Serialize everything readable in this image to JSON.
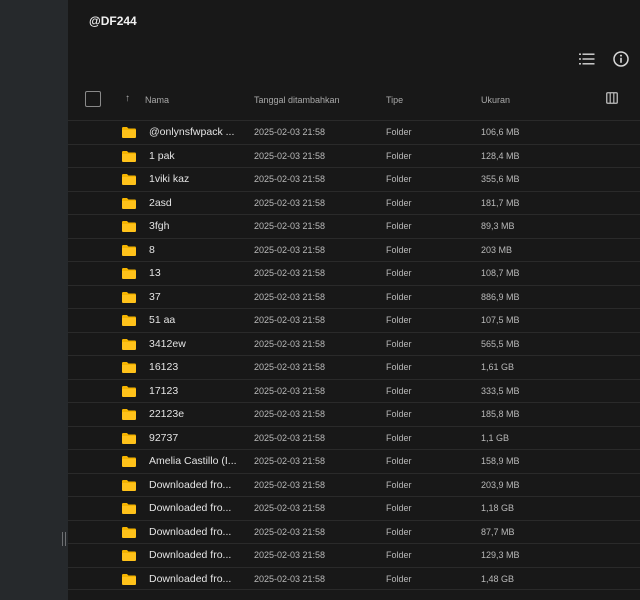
{
  "app": {
    "title": "@DF244"
  },
  "toolbar": {
    "list_view_icon": "list-view-icon",
    "info_icon": "info-icon"
  },
  "columns": {
    "name": "Nama",
    "date_added": "Tanggal ditambahkan",
    "type": "Tipe",
    "size": "Ukuran"
  },
  "colors": {
    "folder": "#f5b400",
    "background": "#181818",
    "sidebar": "#26292c"
  },
  "files": [
    {
      "name": "@onlynsfwpack ...",
      "date": "2025-02-03 21:58",
      "type": "Folder",
      "size": "106,6 MB"
    },
    {
      "name": "1 pak",
      "date": "2025-02-03 21:58",
      "type": "Folder",
      "size": "128,4 MB"
    },
    {
      "name": "1viki kaz",
      "date": "2025-02-03 21:58",
      "type": "Folder",
      "size": "355,6 MB"
    },
    {
      "name": "2asd",
      "date": "2025-02-03 21:58",
      "type": "Folder",
      "size": "181,7 MB"
    },
    {
      "name": "3fgh",
      "date": "2025-02-03 21:58",
      "type": "Folder",
      "size": "89,3 MB"
    },
    {
      "name": "8",
      "date": "2025-02-03 21:58",
      "type": "Folder",
      "size": "203 MB"
    },
    {
      "name": "13",
      "date": "2025-02-03 21:58",
      "type": "Folder",
      "size": "108,7 MB"
    },
    {
      "name": "37",
      "date": "2025-02-03 21:58",
      "type": "Folder",
      "size": "886,9 MB"
    },
    {
      "name": "51 aa",
      "date": "2025-02-03 21:58",
      "type": "Folder",
      "size": "107,5 MB"
    },
    {
      "name": "3412ew",
      "date": "2025-02-03 21:58",
      "type": "Folder",
      "size": "565,5 MB"
    },
    {
      "name": "16123",
      "date": "2025-02-03 21:58",
      "type": "Folder",
      "size": "1,61 GB"
    },
    {
      "name": "17123",
      "date": "2025-02-03 21:58",
      "type": "Folder",
      "size": "333,5 MB"
    },
    {
      "name": "22123e",
      "date": "2025-02-03 21:58",
      "type": "Folder",
      "size": "185,8 MB"
    },
    {
      "name": "92737",
      "date": "2025-02-03 21:58",
      "type": "Folder",
      "size": "1,1 GB"
    },
    {
      "name": "Amelia Castillo (I...",
      "date": "2025-02-03 21:58",
      "type": "Folder",
      "size": "158,9 MB"
    },
    {
      "name": "Downloaded fro...",
      "date": "2025-02-03 21:58",
      "type": "Folder",
      "size": "203,9 MB"
    },
    {
      "name": "Downloaded fro...",
      "date": "2025-02-03 21:58",
      "type": "Folder",
      "size": "1,18 GB"
    },
    {
      "name": "Downloaded fro...",
      "date": "2025-02-03 21:58",
      "type": "Folder",
      "size": "87,7 MB"
    },
    {
      "name": "Downloaded fro...",
      "date": "2025-02-03 21:58",
      "type": "Folder",
      "size": "129,3 MB"
    },
    {
      "name": "Downloaded fro...",
      "date": "2025-02-03 21:58",
      "type": "Folder",
      "size": "1,48 GB"
    }
  ]
}
